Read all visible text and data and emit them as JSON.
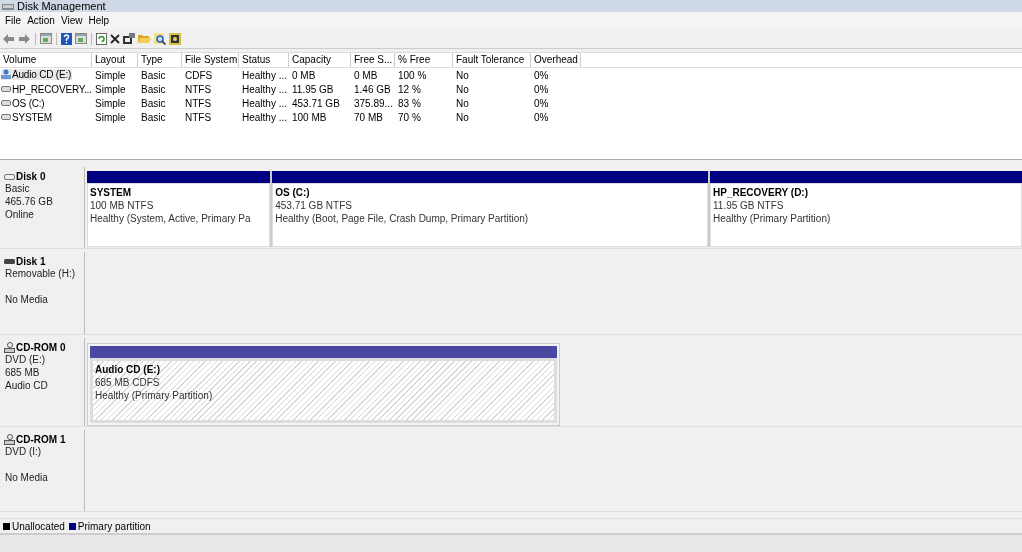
{
  "window": {
    "title": "Disk Management"
  },
  "menu": [
    "File",
    "Action",
    "View",
    "Help"
  ],
  "toolbar": [
    {
      "kind": "back"
    },
    {
      "kind": "forward"
    },
    {
      "kind": "sep"
    },
    {
      "kind": "list"
    },
    {
      "kind": "sep"
    },
    {
      "kind": "help"
    },
    {
      "kind": "list"
    },
    {
      "kind": "sep"
    },
    {
      "kind": "refresh"
    },
    {
      "kind": "delete"
    },
    {
      "kind": "properties"
    },
    {
      "kind": "open"
    },
    {
      "kind": "search"
    },
    {
      "kind": "settings"
    }
  ],
  "table": {
    "columns": [
      "Volume",
      "Layout",
      "Type",
      "File System",
      "Status",
      "Capacity",
      "Free S...",
      "% Free",
      "Fault Tolerance",
      "Overhead"
    ],
    "rows": [
      {
        "kind": "cd",
        "selected": true,
        "cells": [
          "Audio CD (E:)",
          "Simple",
          "Basic",
          "CDFS",
          "Healthy ...",
          "0 MB",
          "0 MB",
          "100 %",
          "No",
          "0%"
        ]
      },
      {
        "kind": "drive",
        "selected": false,
        "cells": [
          "HP_RECOVERY...",
          "Simple",
          "Basic",
          "NTFS",
          "Healthy ...",
          "11.95 GB",
          "1.46 GB",
          "12 %",
          "No",
          "0%"
        ]
      },
      {
        "kind": "drive",
        "selected": false,
        "cells": [
          "OS (C:)",
          "Simple",
          "Basic",
          "NTFS",
          "Healthy ...",
          "453.71 GB",
          "375.89...",
          "83 %",
          "No",
          "0%"
        ]
      },
      {
        "kind": "drive",
        "selected": false,
        "cells": [
          "SYSTEM",
          "Simple",
          "Basic",
          "NTFS",
          "Healthy ...",
          "100 MB",
          "70 MB",
          "70 %",
          "No",
          "0%"
        ]
      }
    ]
  },
  "disks": [
    {
      "kind": "disk",
      "name": "Disk 0",
      "type": "Basic",
      "size": "465.76 GB",
      "status": "Online",
      "partitions": [
        {
          "name": "SYSTEM",
          "size": "100 MB NTFS",
          "health": "Healthy (System, Active, Primary Pa",
          "selected": false
        },
        {
          "name": "OS  (C:)",
          "size": "453.71 GB NTFS",
          "health": "Healthy (Boot, Page File, Crash Dump, Primary Partition)",
          "selected": false
        },
        {
          "name": "HP_RECOVERY  (D:)",
          "size": "11.95 GB NTFS",
          "health": "Healthy (Primary Partition)",
          "selected": false
        }
      ]
    },
    {
      "kind": "removable",
      "name": "Disk 1",
      "type": "Removable (H:)",
      "status": "No Media"
    },
    {
      "kind": "cdrom",
      "name": "CD-ROM 0",
      "type": "DVD (E:)",
      "size": "685 MB",
      "status": "Audio CD",
      "partitions": [
        {
          "name": "Audio CD  (E:)",
          "size": "685 MB CDFS",
          "health": "Healthy (Primary Partition)",
          "selected": true
        }
      ]
    },
    {
      "kind": "cdrom",
      "name": "CD-ROM 1",
      "type": "DVD (I:)",
      "status": "No Media"
    }
  ],
  "legend": [
    {
      "label": "Unallocated",
      "color": "#000000"
    },
    {
      "label": "Primary partition",
      "color": "#000080"
    }
  ]
}
